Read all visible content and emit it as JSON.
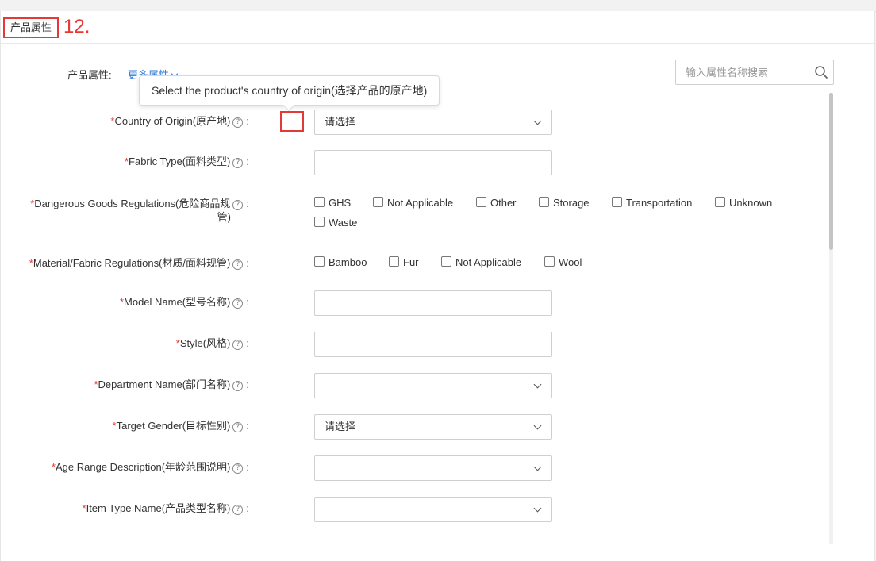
{
  "section": {
    "title": "产品属性",
    "annotation": "12."
  },
  "toolbar": {
    "attr_label": "产品属性:",
    "more_link": "更多属性",
    "search_placeholder": "输入属性名称搜索"
  },
  "tooltip": {
    "text": "Select the product's country of origin(选择产品的原产地)"
  },
  "fields": [
    {
      "label": "Country of Origin(原产地)",
      "required": "*",
      "type": "select",
      "value": "请选择"
    },
    {
      "label": "Fabric Type(面料类型)",
      "required": "*",
      "type": "text",
      "value": ""
    },
    {
      "label_line1": "Dangerous Goods Regulations(危险商品规",
      "label_line2": "管)",
      "required": "*",
      "type": "checkbox",
      "options": [
        "GHS",
        "Not Applicable",
        "Other",
        "Storage",
        "Transportation",
        "Unknown",
        "Waste"
      ]
    },
    {
      "label": "Material/Fabric Regulations(材质/面料规管)",
      "required": "*",
      "type": "checkbox",
      "options": [
        "Bamboo",
        "Fur",
        "Not Applicable",
        "Wool"
      ]
    },
    {
      "label": "Model Name(型号名称)",
      "required": "*",
      "type": "text",
      "value": ""
    },
    {
      "label": "Style(风格)",
      "required": "*",
      "type": "text",
      "value": ""
    },
    {
      "label": "Department Name(部门名称)",
      "required": "*",
      "type": "select",
      "value": ""
    },
    {
      "label": "Target Gender(目标性别)",
      "required": "*",
      "type": "select",
      "value": "请选择"
    },
    {
      "label": "Age Range Description(年龄范围说明)",
      "required": "*",
      "type": "select",
      "value": ""
    },
    {
      "label": "Item Type Name(产品类型名称)",
      "required": "*",
      "type": "select",
      "value": ""
    }
  ],
  "help_icon_glyph": "?",
  "colon": ":",
  "colors": {
    "required": "#e53935",
    "link": "#2f7bd8",
    "annotation": "#e53935"
  }
}
